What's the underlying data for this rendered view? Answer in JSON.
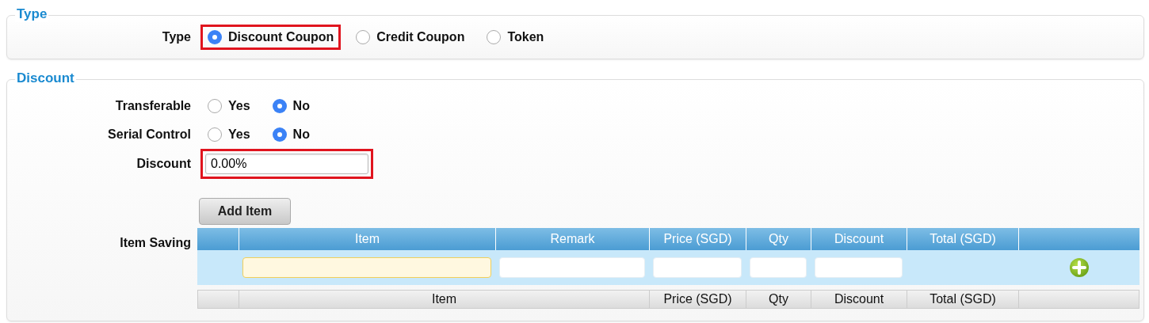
{
  "type_section": {
    "legend": "Type",
    "fields": [
      {
        "kind": "radio",
        "label": "Type",
        "options": [
          {
            "label": "Discount Coupon",
            "selected": true,
            "highlighted": true
          },
          {
            "label": "Credit Coupon",
            "selected": false,
            "highlighted": false
          },
          {
            "label": "Token",
            "selected": false,
            "highlighted": false
          }
        ]
      }
    ]
  },
  "discount_section": {
    "legend": "Discount",
    "fields": [
      {
        "kind": "radio",
        "label": "Transferable",
        "options": [
          {
            "label": "Yes",
            "selected": false,
            "highlighted": false
          },
          {
            "label": "No",
            "selected": true,
            "highlighted": false
          }
        ]
      },
      {
        "kind": "radio",
        "label": "Serial Control",
        "options": [
          {
            "label": "Yes",
            "selected": false,
            "highlighted": false
          },
          {
            "label": "No",
            "selected": true,
            "highlighted": false
          }
        ]
      },
      {
        "kind": "text",
        "label": "Discount",
        "value": "0.00%",
        "highlighted": true
      }
    ],
    "item_saving": {
      "label": "Item Saving",
      "add_button": "Add Item",
      "columns": [
        "Item",
        "Remark",
        "Price (SGD)",
        "Qty",
        "Discount",
        "Total (SGD)"
      ],
      "entry_fields": [
        {
          "required": true
        },
        {
          "required": false
        },
        {
          "required": false
        },
        {
          "required": false
        },
        {
          "required": false
        }
      ],
      "footer": [
        "Item",
        "Price (SGD)",
        "Qty",
        "Discount",
        "Total (SGD)"
      ]
    }
  }
}
